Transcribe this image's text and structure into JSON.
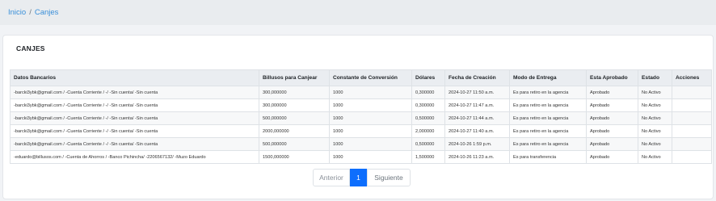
{
  "breadcrumb": {
    "home": "Inicio",
    "separator": "/",
    "current": "Canjes"
  },
  "card": {
    "title": "CANJES"
  },
  "table": {
    "columns": [
      "Datos Bancarios",
      "Billusos para Canjear",
      "Constante de Conversión",
      "Dólares",
      "Fecha de Creación",
      "Modo de Entrega",
      "Esta Aprobado",
      "Estado",
      "Acciones"
    ],
    "rows": [
      [
        "-barcki3ybk@gmail.com / -Cuenta Corriente / -/ -Sin cuenta/ -Sin cuenta",
        "300,000000",
        "1000",
        "0,300000",
        "2024-10-27 11:50 a.m.",
        "Es para retiro en la agencia",
        "Aprobado",
        "No Activo",
        ""
      ],
      [
        "-barcki3ybk@gmail.com / -Cuenta Corriente / -/ -Sin cuenta/ -Sin cuenta",
        "300,000000",
        "1000",
        "0,300000",
        "2024-10-27 11:47 a.m.",
        "Es para retiro en la agencia",
        "Aprobado",
        "No Activo",
        ""
      ],
      [
        "-barcki3ybk@gmail.com / -Cuenta Corriente / -/ -Sin cuenta/ -Sin cuenta",
        "500,000000",
        "1000",
        "0,500000",
        "2024-10-27 11:44 a.m.",
        "Es para retiro en la agencia",
        "Aprobado",
        "No Activo",
        ""
      ],
      [
        "-barcki3ybk@gmail.com / -Cuenta Corriente / -/ -Sin cuenta/ -Sin cuenta",
        "2000,000000",
        "1000",
        "2,000000",
        "2024-10-27 11:40 a.m.",
        "Es para retiro en la agencia",
        "Aprobado",
        "No Activo",
        ""
      ],
      [
        "-barcki3ybk@gmail.com / -Cuenta Corriente / -/ -Sin cuenta/ -Sin cuenta",
        "500,000000",
        "1000",
        "0,500000",
        "2024-10-26 1:59 p.m.",
        "Es para retiro en la agencia",
        "Aprobado",
        "No Activo",
        ""
      ],
      [
        "-eduardo@billusos.com / -Cuenta de Ahorros / -Banco Pichincha/ -2206567132/ -Muzo Eduardo",
        "1500,000000",
        "1000",
        "1,500000",
        "2024-10-26 11:23 a.m.",
        "Es para transferencia",
        "Aprobado",
        "No Activo",
        ""
      ]
    ]
  },
  "pagination": {
    "prev": "Anterior",
    "current": "1",
    "next": "Siguiente"
  },
  "colors": {
    "accent": "#0d6efd",
    "link": "#3a8fd9",
    "header_bg": "#eaedf1"
  }
}
